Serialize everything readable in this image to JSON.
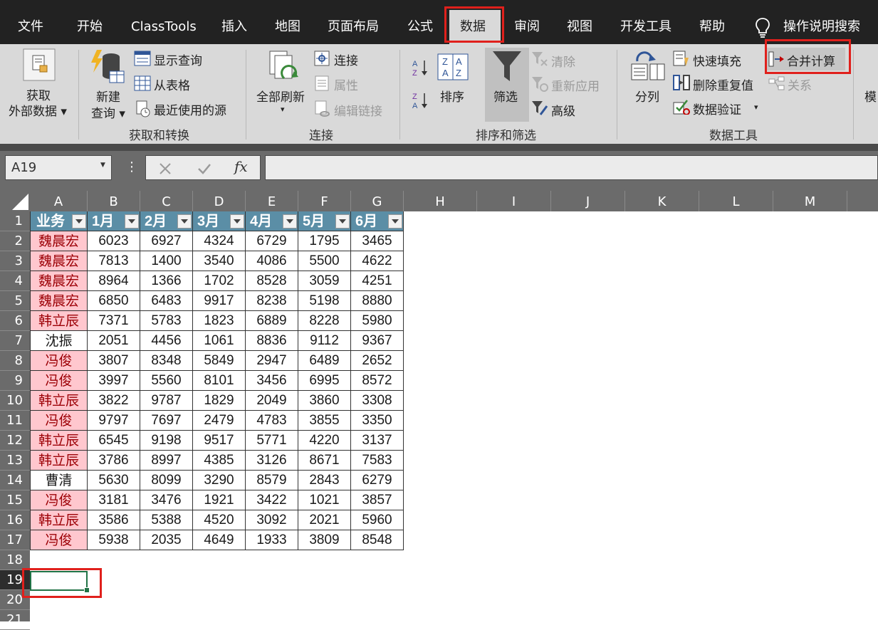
{
  "menu": {
    "tabs": [
      {
        "label": "文件"
      },
      {
        "label": "开始"
      },
      {
        "label": "ClassTools"
      },
      {
        "label": "插入"
      },
      {
        "label": "地图"
      },
      {
        "label": "页面布局"
      },
      {
        "label": "公式"
      },
      {
        "label": "数据",
        "selected": true
      },
      {
        "label": "审阅"
      },
      {
        "label": "视图"
      },
      {
        "label": "开发工具"
      },
      {
        "label": "帮助"
      }
    ],
    "search_label": "操作说明搜索"
  },
  "ribbon": {
    "get_external_data_label": "获取\n外部数据",
    "new_query_label": "新建\n查询",
    "show_query_label": "显示查询",
    "from_table_label": "从表格",
    "recent_sources_label": "最近使用的源",
    "group_get_transform": "获取和转换",
    "refresh_all_label": "全部刷新",
    "connections_label": "连接",
    "properties_label": "属性",
    "edit_links_label": "编辑链接",
    "group_connections": "连接",
    "sort_label": "排序",
    "filter_label": "筛选",
    "clear_label": "清除",
    "reapply_label": "重新应用",
    "advanced_label": "高级",
    "group_sort_filter": "排序和筛选",
    "text_to_columns_label": "分列",
    "flash_fill_label": "快速填充",
    "remove_duplicates_label": "删除重复值",
    "data_validation_label": "数据验证",
    "consolidate_label": "合并计算",
    "relationships_label": "关系",
    "group_data_tools": "数据工具",
    "model_label": "模"
  },
  "formula_bar": {
    "name_box": "A19",
    "formula": ""
  },
  "sheet": {
    "columns": [
      "A",
      "B",
      "C",
      "D",
      "E",
      "F",
      "G",
      "H",
      "I",
      "J",
      "K",
      "L",
      "M"
    ],
    "rows": [
      "1",
      "2",
      "3",
      "4",
      "5",
      "6",
      "7",
      "8",
      "9",
      "10",
      "11",
      "12",
      "13",
      "14",
      "15",
      "16",
      "17",
      "18",
      "19",
      "20",
      "21"
    ],
    "selected_row": "19",
    "selected_cell": "A19",
    "table_headers": [
      "业务",
      "1月",
      "2月",
      "3月",
      "4月",
      "5月",
      "6月"
    ],
    "table_rows": [
      {
        "name": "魏晨宏",
        "dup": true,
        "values": [
          "6023",
          "6927",
          "4324",
          "6729",
          "1795",
          "3465"
        ]
      },
      {
        "name": "魏晨宏",
        "dup": true,
        "values": [
          "7813",
          "1400",
          "3540",
          "4086",
          "5500",
          "4622"
        ]
      },
      {
        "name": "魏晨宏",
        "dup": true,
        "values": [
          "8964",
          "1366",
          "1702",
          "8528",
          "3059",
          "4251"
        ]
      },
      {
        "name": "魏晨宏",
        "dup": true,
        "values": [
          "6850",
          "6483",
          "9917",
          "8238",
          "5198",
          "8880"
        ]
      },
      {
        "name": "韩立辰",
        "dup": true,
        "values": [
          "7371",
          "5783",
          "1823",
          "6889",
          "8228",
          "5980"
        ]
      },
      {
        "name": "沈振",
        "dup": false,
        "values": [
          "2051",
          "4456",
          "1061",
          "8836",
          "9112",
          "9367"
        ]
      },
      {
        "name": "冯俊",
        "dup": true,
        "values": [
          "3807",
          "8348",
          "5849",
          "2947",
          "6489",
          "2652"
        ]
      },
      {
        "name": "冯俊",
        "dup": true,
        "values": [
          "3997",
          "5560",
          "8101",
          "3456",
          "6995",
          "8572"
        ]
      },
      {
        "name": "韩立辰",
        "dup": true,
        "values": [
          "3822",
          "9787",
          "1829",
          "2049",
          "3860",
          "3308"
        ]
      },
      {
        "name": "冯俊",
        "dup": true,
        "values": [
          "9797",
          "7697",
          "2479",
          "4783",
          "3855",
          "3350"
        ]
      },
      {
        "name": "韩立辰",
        "dup": true,
        "values": [
          "6545",
          "9198",
          "9517",
          "5771",
          "4220",
          "3137"
        ]
      },
      {
        "name": "韩立辰",
        "dup": true,
        "values": [
          "3786",
          "8997",
          "4385",
          "3126",
          "8671",
          "7583"
        ]
      },
      {
        "name": "曹清",
        "dup": false,
        "values": [
          "5630",
          "8099",
          "3290",
          "8579",
          "2843",
          "6279"
        ]
      },
      {
        "name": "冯俊",
        "dup": true,
        "values": [
          "3181",
          "3476",
          "1921",
          "3422",
          "1021",
          "3857"
        ]
      },
      {
        "name": "韩立辰",
        "dup": true,
        "values": [
          "3586",
          "5388",
          "4520",
          "3092",
          "2021",
          "5960"
        ]
      },
      {
        "name": "冯俊",
        "dup": true,
        "values": [
          "5938",
          "2035",
          "4649",
          "1933",
          "3809",
          "8548"
        ]
      }
    ]
  },
  "colors": {
    "menubar_bg": "#222222",
    "ribbon_bg": "#d9d9d9",
    "header_fill": "#5b8ea6",
    "duplicate_fill": "#ffc7ce",
    "duplicate_text": "#9c0006",
    "highlight_box": "#e0201c",
    "active_cell_border": "#217346"
  }
}
